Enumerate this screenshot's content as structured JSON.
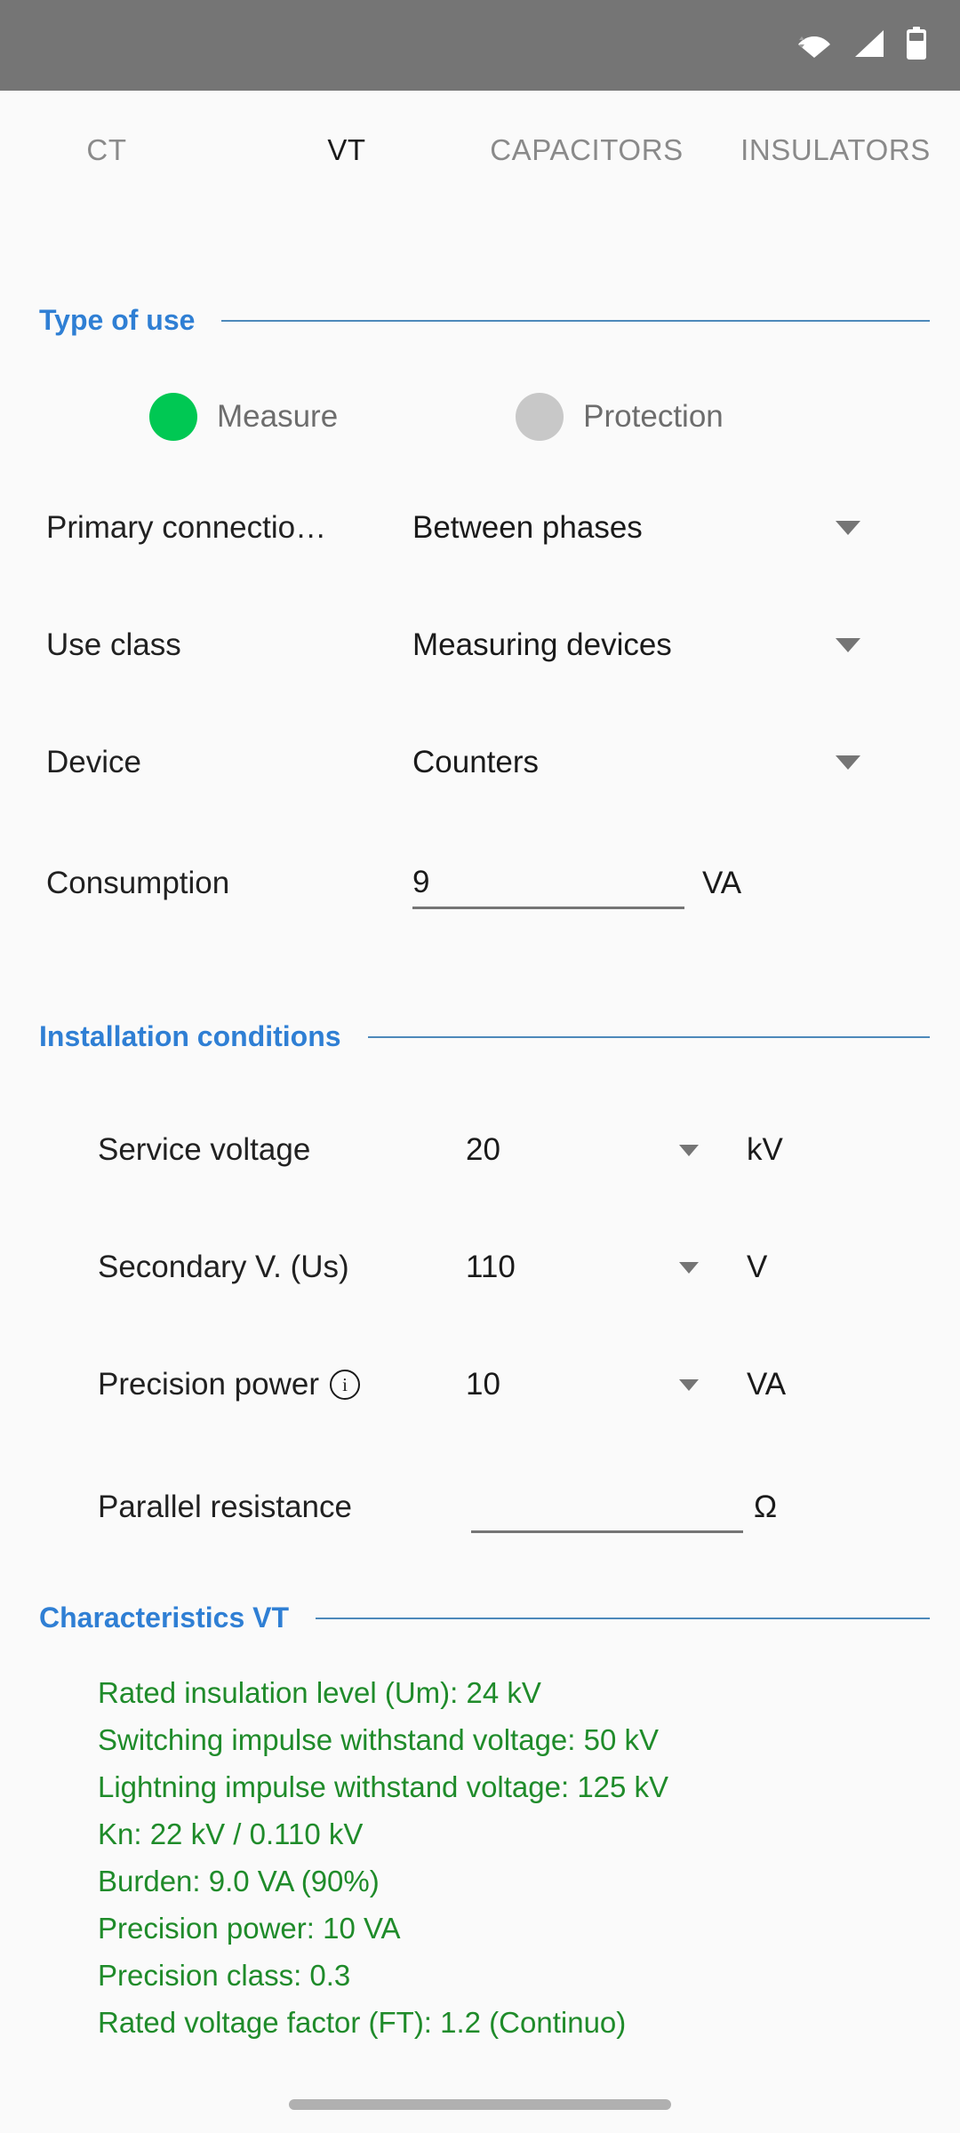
{
  "status_bar": {
    "background": "#757575",
    "icons": [
      "wifi-icon",
      "cellular-signal-icon",
      "battery-icon"
    ]
  },
  "tabs": {
    "items": [
      {
        "label": "CT",
        "active": false
      },
      {
        "label": "VT",
        "active": true
      },
      {
        "label": "CAPACITORS",
        "active": false
      },
      {
        "label": "INSULATORS",
        "active": false
      }
    ],
    "active_index": 1,
    "active_color": "#1a1a1a",
    "inactive_color": "#8a8a8a",
    "indicator_color": "#cfcfcf"
  },
  "sections": {
    "type_of_use": {
      "title": "Type of use",
      "accent": "#2f7fd4",
      "options": [
        {
          "label": "Measure",
          "selected": true,
          "color": "#00c853"
        },
        {
          "label": "Protection",
          "selected": false,
          "color": "#c8c8c8"
        }
      ],
      "fields": [
        {
          "label": "Primary connectio…",
          "value": "Between phases",
          "unit": "",
          "control": "dropdown"
        },
        {
          "label": "Use class",
          "value": "Measuring devices",
          "unit": "",
          "control": "dropdown"
        },
        {
          "label": "Device",
          "value": "Counters",
          "unit": "",
          "control": "dropdown"
        },
        {
          "label": "Consumption",
          "value": "9",
          "unit": "VA",
          "control": "text-input"
        }
      ]
    },
    "installation_conditions": {
      "title": "Installation conditions",
      "accent": "#2f7fd4",
      "fields": [
        {
          "label": "Service voltage",
          "value": "20",
          "unit": "kV",
          "control": "dropdown",
          "info": false
        },
        {
          "label": "Secondary V. (Us)",
          "value": "110",
          "unit": "V",
          "control": "dropdown",
          "info": false
        },
        {
          "label": "Precision power",
          "value": "10",
          "unit": "VA",
          "control": "dropdown",
          "info": true
        },
        {
          "label": "Parallel resistance",
          "value": "",
          "unit": "Ω",
          "control": "text-input",
          "info": false
        }
      ]
    },
    "characteristics_vt": {
      "title": "Characteristics VT",
      "accent": "#2f7fd4",
      "text_color": "#1f8b2a",
      "lines": [
        "Rated insulation level (Um): 24 kV",
        "Switching impulse withstand voltage: 50 kV",
        "Lightning impulse withstand voltage: 125 kV",
        "Kn: 22 kV / 0.110 kV",
        "Burden: 9.0 VA (90%)",
        "Precision power: 10 VA",
        "Precision class: 0.3",
        "Rated voltage factor (FT): 1.2 (Continuo)"
      ]
    }
  }
}
